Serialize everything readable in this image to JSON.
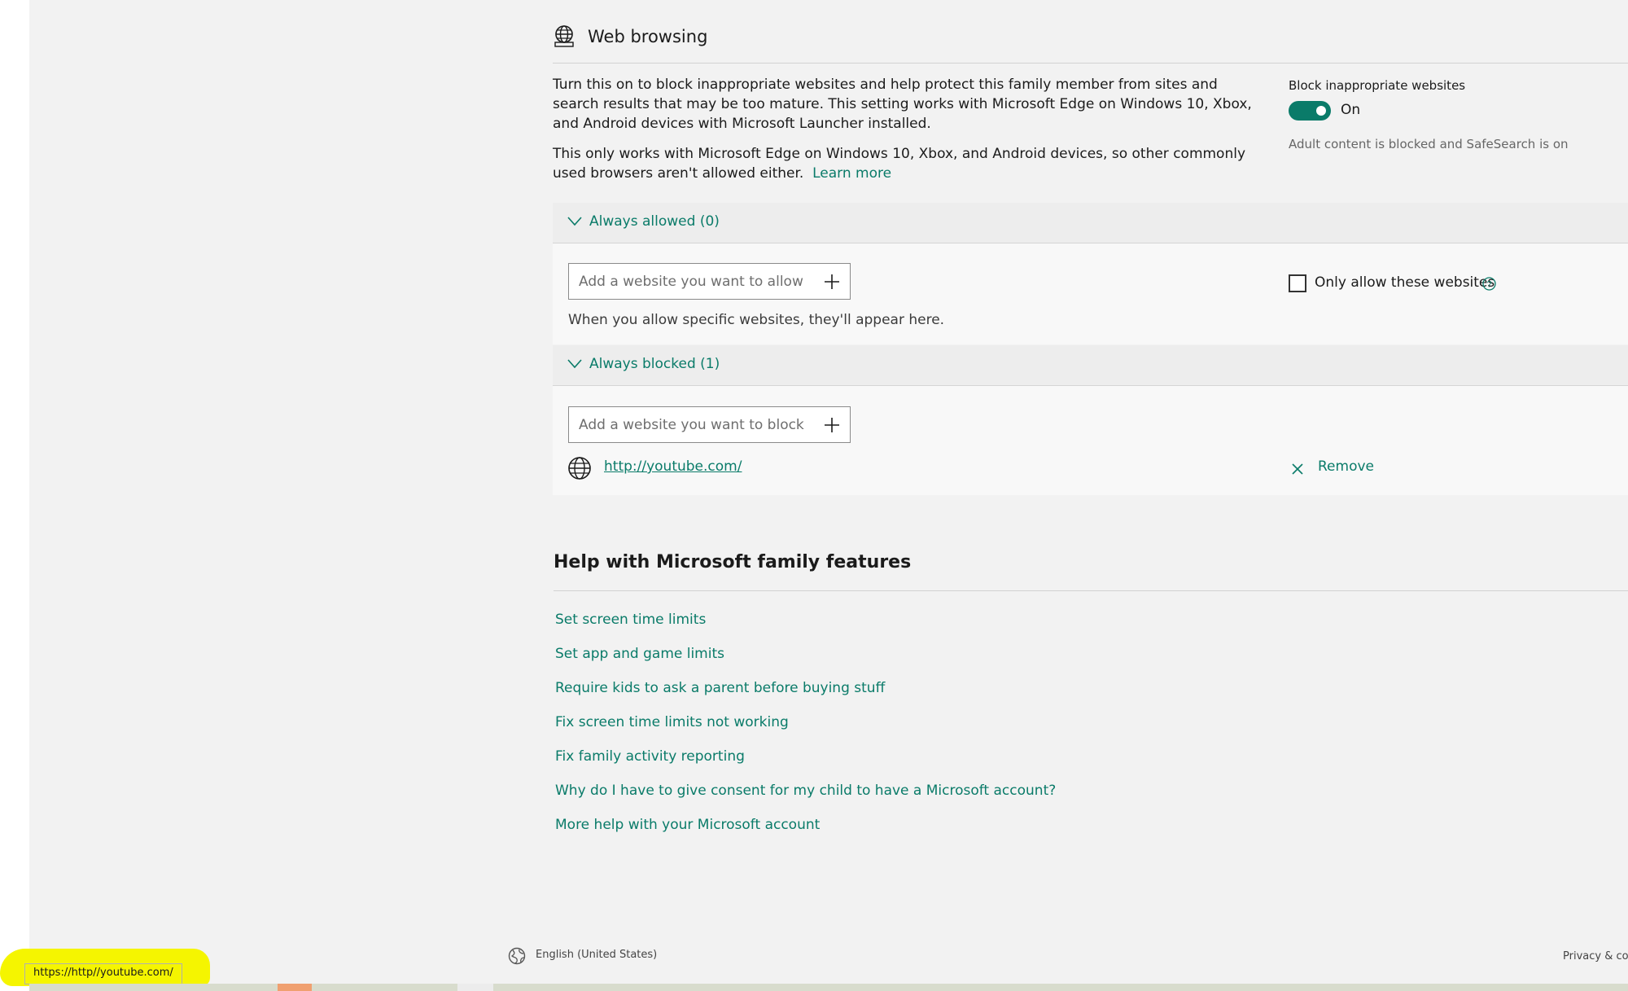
{
  "web_browsing": {
    "title": "Web browsing",
    "description_1": "Turn this on to block inappropriate websites and help protect this family member from sites and search results that may be too mature. This setting works with Microsoft Edge on Windows 10, Xbox, and Android devices with Microsoft Launcher installed.",
    "description_2": "This only works with Microsoft Edge on Windows 10, Xbox, and Android devices, so other commonly used browsers aren't allowed either.",
    "learn_more": "Learn more",
    "toggle_label": "Block inappropriate websites",
    "toggle_state": "On",
    "toggle_on": true,
    "toggle_note": "Adult content is blocked and SafeSearch is on"
  },
  "always_allowed": {
    "header": "Always allowed (0)",
    "input_placeholder": "Add a website you want to allow",
    "empty_note": "When you allow specific websites, they'll appear here.",
    "only_allow_label": "Only allow these websites",
    "only_allow_checked": false
  },
  "always_blocked": {
    "header": "Always blocked (1)",
    "input_placeholder": "Add a website you want to block",
    "sites": [
      {
        "url": "http://youtube.com/",
        "remove_label": "Remove"
      }
    ]
  },
  "help": {
    "title": "Help with Microsoft family features",
    "links": [
      "Set screen time limits",
      "Set app and game limits",
      "Require kids to ask a parent before buying stuff",
      "Fix screen time limits not working",
      "Fix family activity reporting",
      "Why do I have to give consent for my child to have a Microsoft account?",
      "More help with your Microsoft account"
    ]
  },
  "footer": {
    "language": "English (United States)",
    "privacy": "Privacy & coo"
  },
  "status_bar": {
    "url": "https://http//youtube.com/"
  },
  "colors": {
    "accent": "#0a7b69",
    "background": "#f2f2f2",
    "highlight": "#f5f500"
  }
}
